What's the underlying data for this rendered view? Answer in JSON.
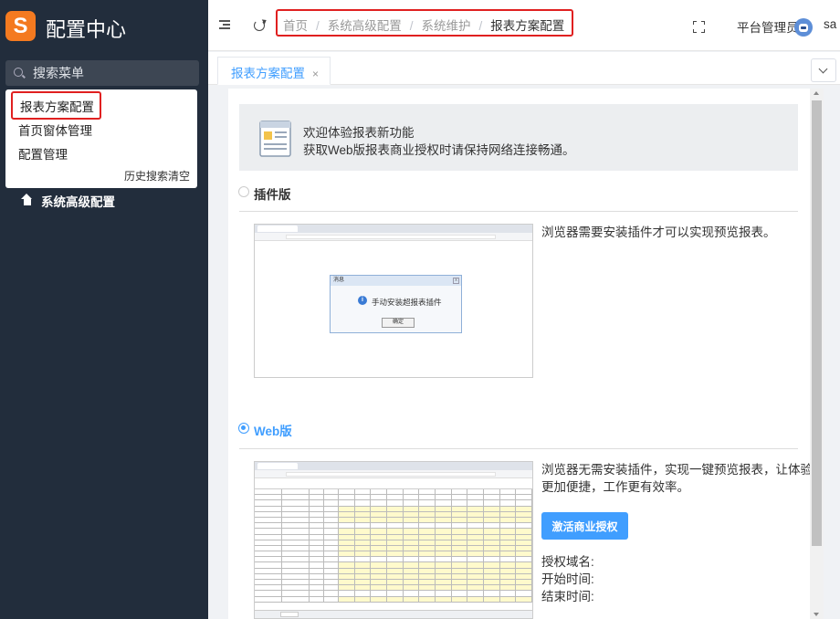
{
  "app": {
    "logo_letter": "S",
    "title": "配置中心"
  },
  "sidebar": {
    "search_placeholder": "搜索菜单",
    "dropdown_items": [
      {
        "label": "报表方案配置",
        "highlighted": true
      },
      {
        "label": "首页窗体管理"
      },
      {
        "label": "配置管理"
      }
    ],
    "history_clear": "历史搜索清空",
    "nav_items": [
      {
        "label": "系统高级配置",
        "icon": "home-icon"
      }
    ]
  },
  "header": {
    "breadcrumb": [
      "首页",
      "系统高级配置",
      "系统维护",
      "报表方案配置"
    ],
    "breadcrumb_separator": "/",
    "user_role": "平台管理员",
    "user_name": "sa"
  },
  "tabs": [
    {
      "label": "报表方案配置",
      "close": "×",
      "active": true
    }
  ],
  "content": {
    "notice": {
      "line1": "欢迎体验报表新功能",
      "line2": "获取Web版报表商业授权时请保持网络连接畅通。"
    },
    "plugin_option": {
      "label": "插件版",
      "selected": false,
      "description": "浏览器需要安装插件才可以实现预览报表。",
      "dialog": {
        "title": "消息",
        "close": "x",
        "message": "手动安装超报表插件",
        "button": "确定"
      }
    },
    "web_option": {
      "label": "Web版",
      "selected": true,
      "description_line1": "浏览器无需安装插件，实现一键预览报表，让体验",
      "description_line2": "更加便捷，工作更有效率。",
      "activate_button": "激活商业授权",
      "license_domain": "授权域名:",
      "start_time": "开始时间:",
      "end_time": "结束时间:"
    }
  },
  "colors": {
    "sidebar_bg": "#222d3c",
    "accent": "#409eff",
    "logo": "#f47a20",
    "highlight_border": "#e02020"
  }
}
